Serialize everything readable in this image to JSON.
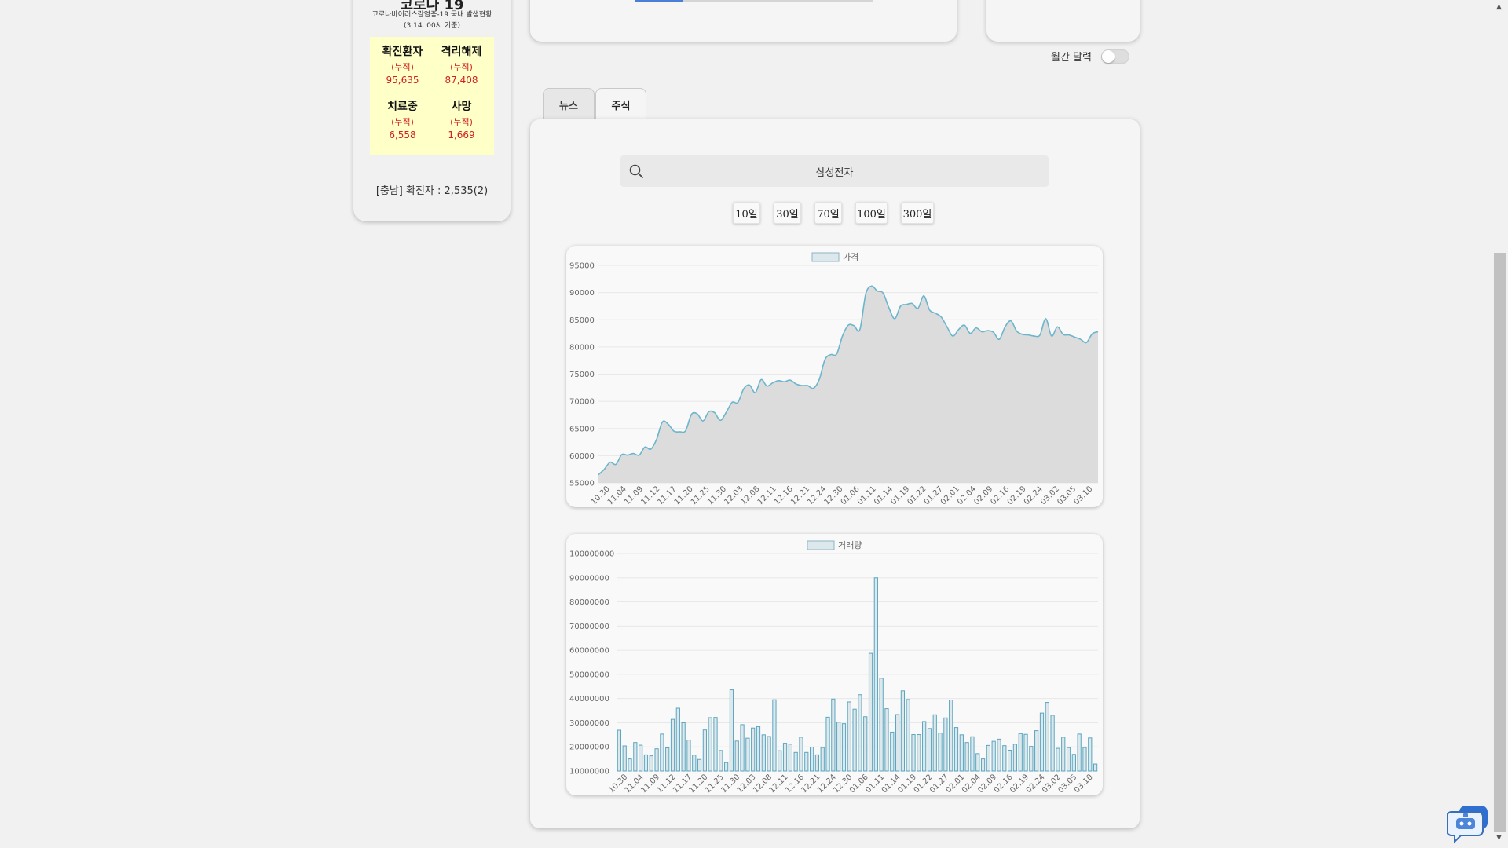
{
  "covid": {
    "title": "코로나 19",
    "subtitle_line1": "코로나바이러스감염증-19 국내 발생현황",
    "subtitle_line2": "(3.14. 00시 기준)",
    "confirmed": {
      "label": "확진환자",
      "acc": "(누적)",
      "value": "95,635"
    },
    "released": {
      "label": "격리해제",
      "acc": "(누적)",
      "value": "87,408"
    },
    "treating": {
      "label": "치료중",
      "acc": "(누적)",
      "value": "6,558"
    },
    "deaths": {
      "label": "사망",
      "acc": "(누적)",
      "value": "1,669"
    },
    "region_text": "[충남] 확진자 : 2,535(2)"
  },
  "calendar": {
    "monthly_label": "월간 달력",
    "monthly_on": false
  },
  "tabs": [
    {
      "label": "뉴스",
      "active": false
    },
    {
      "label": "주식",
      "active": true
    }
  ],
  "search": {
    "value": "삼성전자"
  },
  "ranges": [
    "10일",
    "30일",
    "70일",
    "100일",
    "300일"
  ],
  "colors": {
    "line": "#6cb5cc",
    "fill": "#dcdcdc",
    "bar_stroke": "#5aa5bf",
    "bar_fill": "#dde8ec",
    "progress": "#4a7fd6"
  },
  "chart_data": [
    {
      "type": "area",
      "legend": "가격",
      "ylim": [
        55000,
        95000
      ],
      "yticks": [
        95000,
        90000,
        85000,
        80000,
        75000,
        70000,
        65000,
        60000,
        55000
      ],
      "xticks": [
        "10.30",
        "11.04",
        "11.09",
        "11.12",
        "11.17",
        "11.20",
        "11.25",
        "11.30",
        "12.03",
        "12.08",
        "12.11",
        "12.16",
        "12.21",
        "12.24",
        "12.30",
        "01.06",
        "01.11",
        "01.14",
        "01.19",
        "01.22",
        "01.27",
        "02.01",
        "02.04",
        "02.09",
        "02.16",
        "02.19",
        "02.24",
        "03.02",
        "03.05",
        "03.10"
      ],
      "values": [
        56500,
        57500,
        58800,
        58400,
        60200,
        60100,
        60400,
        60100,
        61600,
        61200,
        63000,
        66200,
        65800,
        64500,
        64400,
        64600,
        67600,
        67700,
        66400,
        68100,
        67900,
        66500,
        68000,
        69800,
        69800,
        72300,
        73000,
        71600,
        74000,
        72800,
        73400,
        73800,
        73600,
        73900,
        73200,
        72900,
        72900,
        72400,
        74000,
        77700,
        78600,
        78700,
        82000,
        84000,
        83900,
        83200,
        89700,
        91200,
        90300,
        89900,
        87200,
        85200,
        87500,
        87800,
        88000,
        87100,
        89400,
        86800,
        86200,
        85500,
        83700,
        82000,
        83200,
        84000,
        82500,
        83500,
        82800,
        83000,
        82700,
        81400,
        83700,
        84800,
        82900,
        82300,
        82200,
        82000,
        82200,
        85200,
        82000,
        83700,
        82300,
        82200,
        81800,
        81400,
        80800,
        82400,
        82800
      ]
    },
    {
      "type": "bar",
      "legend": "거래량",
      "ylim": [
        10000000,
        100000000
      ],
      "yticks": [
        100000000,
        90000000,
        80000000,
        70000000,
        60000000,
        50000000,
        40000000,
        30000000,
        20000000,
        10000000
      ],
      "xticks": [
        "10.30",
        "11.04",
        "11.09",
        "11.12",
        "11.17",
        "11.20",
        "11.25",
        "11.30",
        "12.03",
        "12.08",
        "12.11",
        "12.16",
        "12.21",
        "12.24",
        "12.30",
        "01.06",
        "01.11",
        "01.14",
        "01.19",
        "01.22",
        "01.27",
        "02.01",
        "02.04",
        "02.09",
        "02.16",
        "02.19",
        "02.24",
        "03.02",
        "03.05",
        "03.10"
      ],
      "values": [
        26900000,
        20400000,
        15000000,
        21800000,
        20700000,
        16700000,
        16300000,
        19200000,
        25300000,
        19600000,
        31400000,
        36000000,
        30000000,
        22800000,
        16600000,
        14800000,
        27000000,
        32100000,
        32200000,
        18500000,
        13500000,
        43600000,
        22400000,
        29200000,
        23600000,
        27800000,
        28400000,
        25000000,
        24300000,
        39500000,
        18400000,
        21500000,
        21100000,
        17700000,
        24000000,
        17700000,
        19900000,
        16700000,
        19700000,
        32300000,
        39800000,
        30200000,
        29600000,
        38600000,
        35600000,
        41600000,
        32500000,
        58700000,
        90000000,
        48400000,
        35800000,
        26100000,
        33400000,
        43200000,
        39600000,
        25100000,
        25100000,
        30500000,
        27600000,
        33300000,
        25700000,
        32000000,
        39400000,
        28000000,
        25000000,
        21800000,
        24200000,
        17200000,
        15000000,
        20600000,
        22300000,
        23200000,
        20500000,
        18600000,
        21100000,
        25500000,
        25200000,
        20200000,
        26700000,
        34000000,
        38400000,
        33100000,
        19400000,
        24000000,
        19700000,
        16900000,
        25300000,
        19700000,
        23700000,
        12900000
      ]
    }
  ]
}
